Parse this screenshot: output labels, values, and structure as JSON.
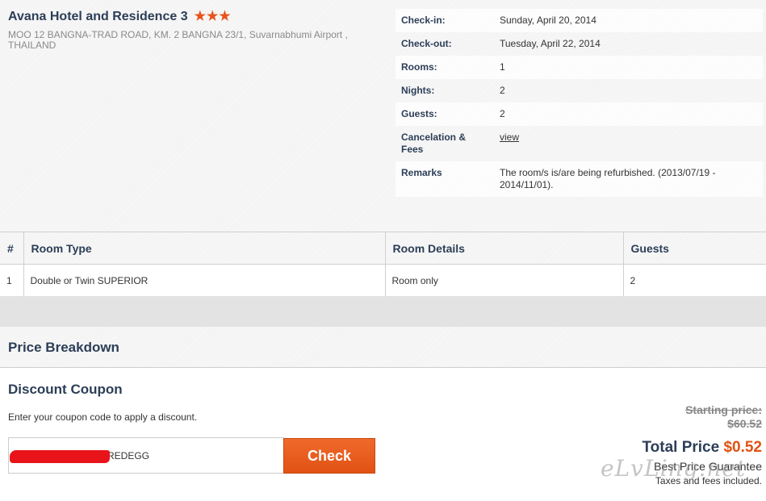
{
  "hotel": {
    "name": "Avana Hotel and Residence 3",
    "stars": "★★★",
    "address": "MOO 12 BANGNA-TRAD ROAD, KM. 2 BANGNA 23/1, Suvarnabhumi Airport , THAILAND"
  },
  "booking": [
    {
      "label": "Check-in:",
      "value": "Sunday, April 20, 2014"
    },
    {
      "label": "Check-out:",
      "value": "Tuesday, April 22, 2014"
    },
    {
      "label": "Rooms:",
      "value": "1"
    },
    {
      "label": "Nights:",
      "value": "2"
    },
    {
      "label": "Guests:",
      "value": "2"
    },
    {
      "label": "Cancelation & Fees",
      "value": "view"
    },
    {
      "label": "Remarks",
      "value": "The room/s is/are being refurbished. (2013/07/19 - 2014/11/01)."
    }
  ],
  "room_table": {
    "headers": [
      "#",
      "Room Type",
      "Room Details",
      "Guests"
    ],
    "rows": [
      [
        "1",
        "Double or Twin SUPERIOR",
        "Room only",
        "2"
      ]
    ]
  },
  "price_breakdown": {
    "title": "Price Breakdown"
  },
  "coupon": {
    "title": "Discount Coupon",
    "description": "Enter your coupon code to apply a discount.",
    "value": "REDEGG",
    "button": "Check"
  },
  "price": {
    "starting_label": "Starting price:",
    "starting_value": "$60.52",
    "total_label": "Total Price",
    "total_value": "$0.52",
    "guarantee": "Best Price Guarantee",
    "taxes": "Taxes and fees included."
  },
  "watermark": "eLvLing.net",
  "colors": {
    "accent": "#e15213",
    "heading": "#2c3e57",
    "star": "#e8541a"
  }
}
